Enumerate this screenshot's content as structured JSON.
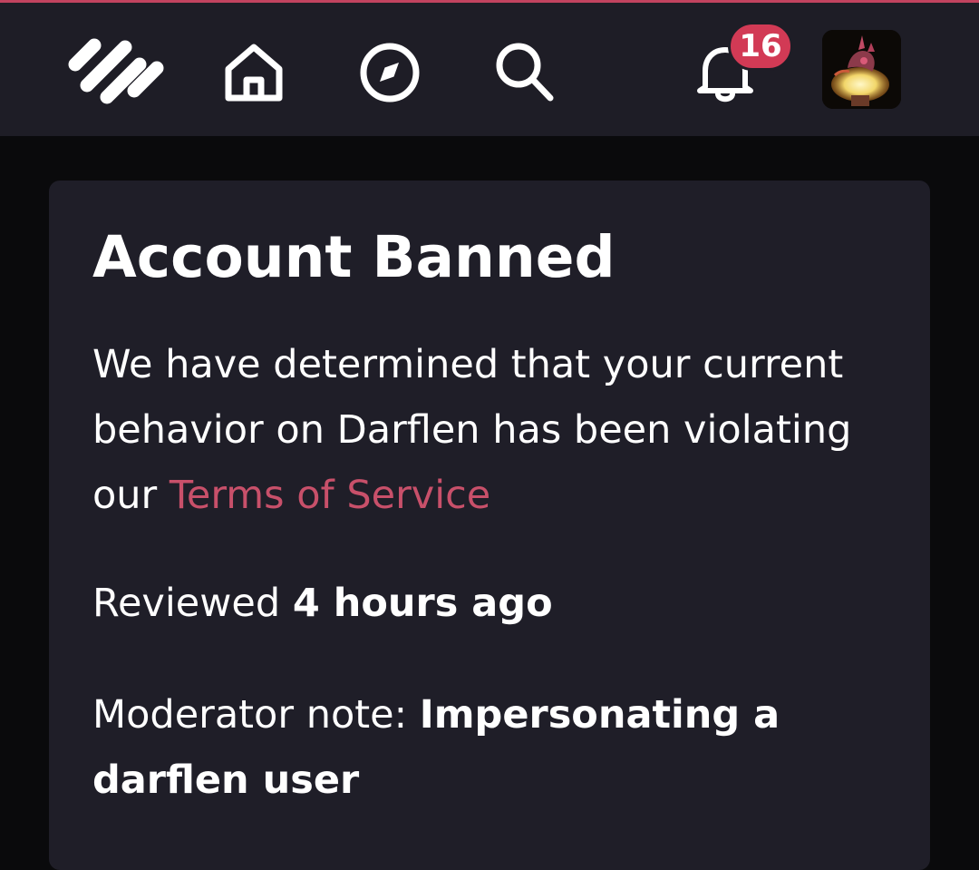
{
  "theme": {
    "accent": "#c2435f",
    "link": "#c8506a",
    "badge": "#d23a55",
    "navbar_bg": "#1e1d26",
    "card_bg": "#1f1e28",
    "page_bg": "#0a0a0c"
  },
  "nav": {
    "logo_icon": "darflen-logo-icon",
    "home_icon": "home-icon",
    "explore_icon": "compass-icon",
    "search_icon": "search-icon",
    "notifications_icon": "bell-icon",
    "notification_count": "16",
    "avatar_icon": "avatar-image"
  },
  "ban": {
    "title": "Account Banned",
    "message_prefix": "We have determined that your current behavior on Darflen has been violating our",
    "tos_link": "Terms of Service",
    "reviewed_label": "Reviewed",
    "reviewed_time": "4 hours ago",
    "note_label": "Moderator note:",
    "note_text": "Impersonating a darflen user"
  }
}
